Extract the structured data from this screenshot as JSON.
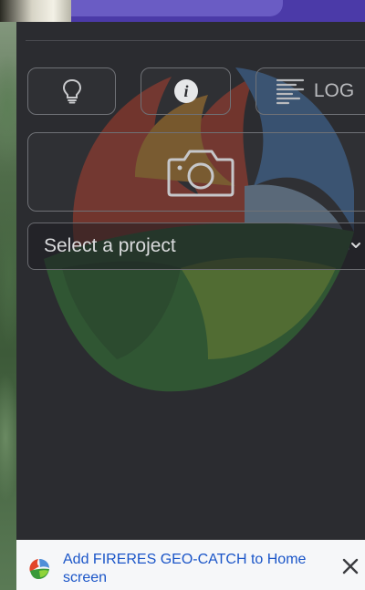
{
  "toolbar": {
    "tip_icon": "lightbulb-icon",
    "info_icon": "info-icon",
    "info_glyph": "i",
    "log_icon": "log-lines-icon",
    "log_label": "LOG"
  },
  "capture": {
    "camera_icon": "camera-icon"
  },
  "project_select": {
    "selected": "Select a project",
    "icon": "chevron-down-icon"
  },
  "install_banner": {
    "text": "Add FIRERES GEO-CATCH to Home screen",
    "app_icon": "app-logo-icon",
    "close_icon": "close-icon"
  },
  "colors": {
    "panel": "#2b2c30",
    "banner_link": "#1a55c8",
    "top_strip": "#4b3aa8"
  }
}
